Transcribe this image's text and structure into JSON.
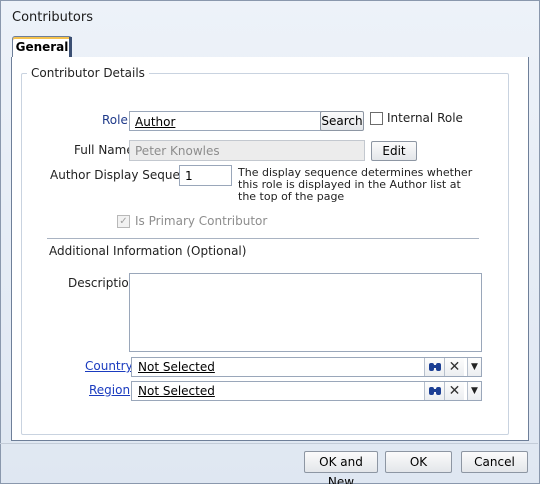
{
  "window": {
    "title": "Contributors"
  },
  "tabs": [
    {
      "label": "General"
    }
  ],
  "contributor_details": {
    "legend": "Contributor Details",
    "role": {
      "label": "Role",
      "value": "Author",
      "search_label": "Search"
    },
    "internal_role": {
      "label": "Internal Role",
      "checked": false
    },
    "full_name": {
      "label": "Full Name",
      "value": "Peter Knowles",
      "edit_label": "Edit"
    },
    "display_sequence": {
      "label": "Author Display Sequence",
      "value": "1",
      "hint": "The display sequence determines whether this role is displayed in the Author list at the top of the page"
    },
    "primary": {
      "label": "Is Primary Contributor",
      "checked": true,
      "disabled": true
    }
  },
  "additional_info": {
    "heading": "Additional Information (Optional)",
    "description_label": "Description",
    "description_value": "",
    "country": {
      "label": "Country",
      "value": "Not Selected"
    },
    "region": {
      "label": "Region",
      "value": "Not Selected"
    }
  },
  "icons": {
    "find": "binoculars-icon",
    "clear": "clear-x-icon",
    "dropdown": "chevron-down-icon"
  },
  "footer": {
    "ok_and_new": "OK and New",
    "ok": "OK",
    "cancel": "Cancel"
  },
  "colors": {
    "accent": "#f4c24f",
    "link": "#1a3bbf",
    "label_blue": "#1f3a8a"
  }
}
